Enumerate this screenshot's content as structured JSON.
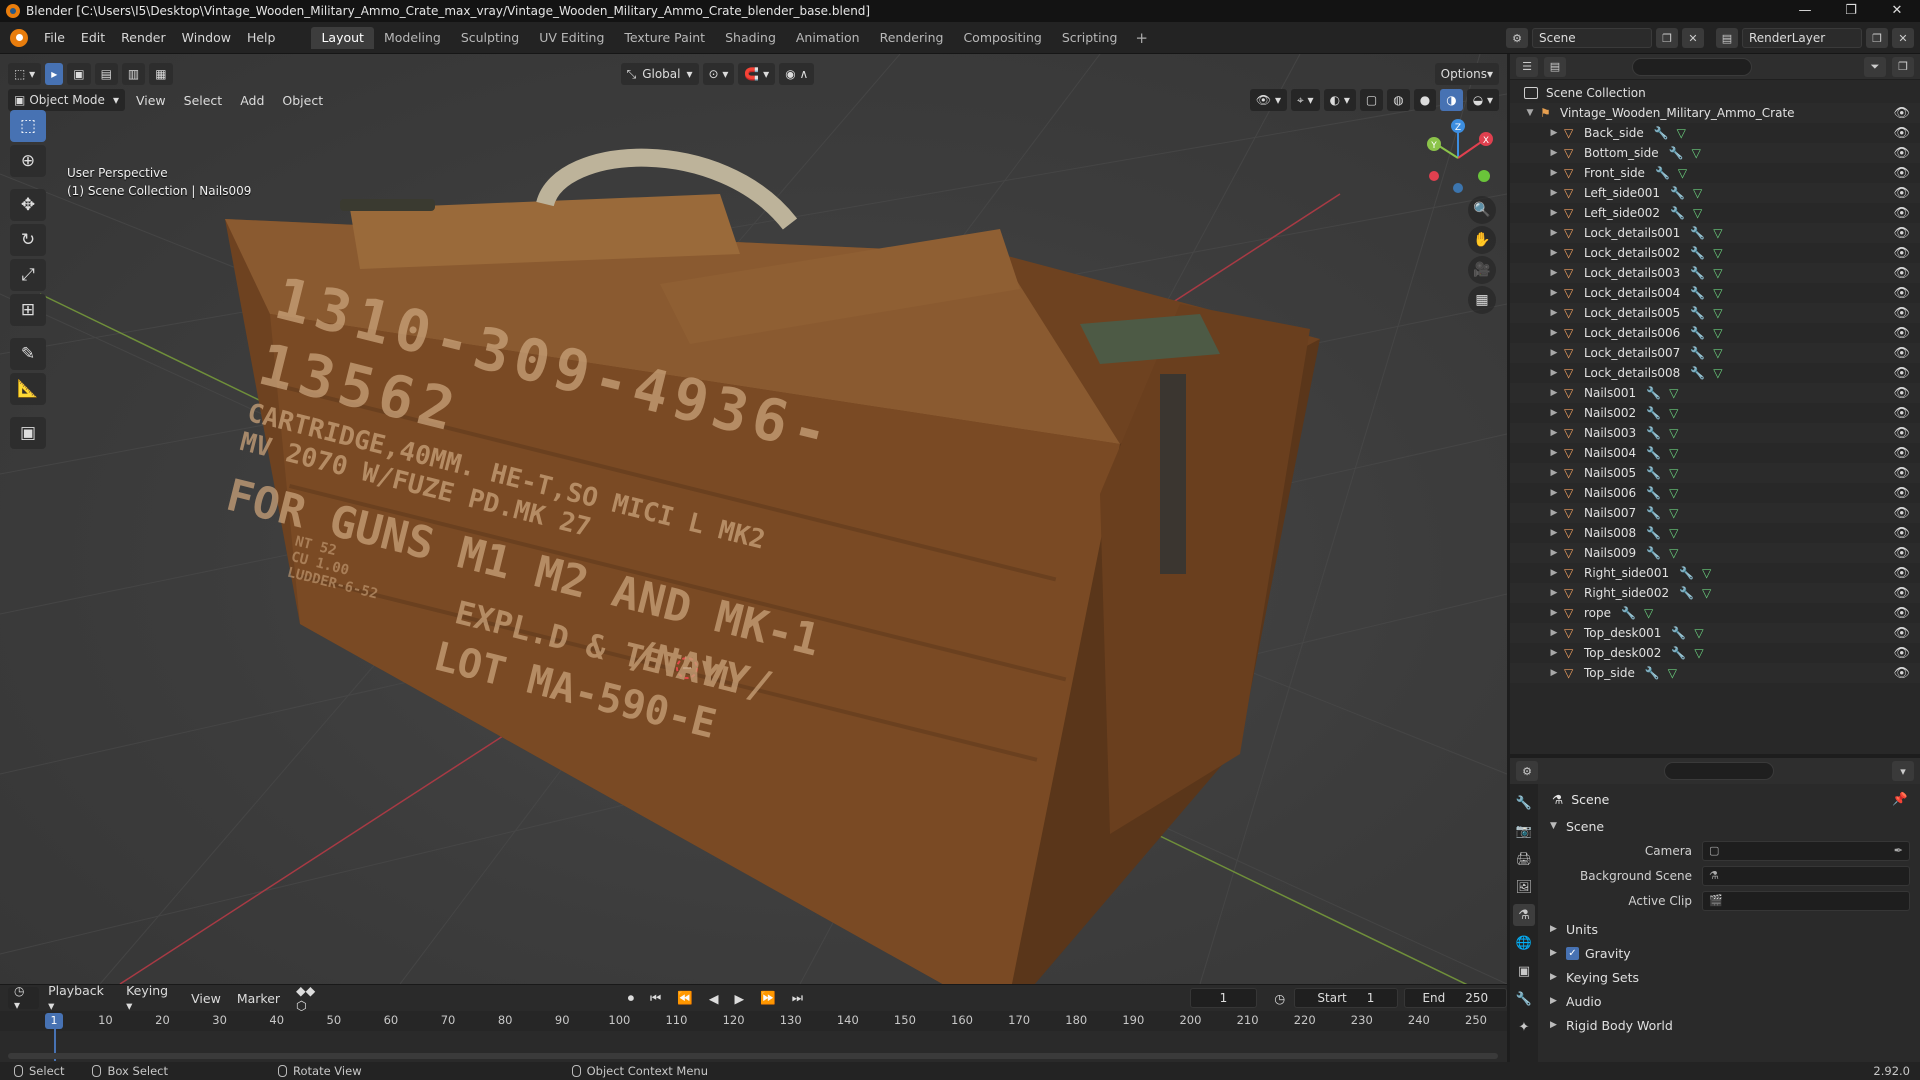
{
  "window": {
    "title": "Blender [C:\\Users\\I5\\Desktop\\Vintage_Wooden_Military_Ammo_Crate_max_vray/Vintage_Wooden_Military_Ammo_Crate_blender_base.blend]",
    "controls": {
      "minimize": "—",
      "maximize": "❐",
      "close": "✕"
    }
  },
  "menu": [
    "File",
    "Edit",
    "Render",
    "Window",
    "Help"
  ],
  "workspaces": [
    {
      "label": "Layout",
      "active": true
    },
    {
      "label": "Modeling"
    },
    {
      "label": "Sculpting"
    },
    {
      "label": "UV Editing"
    },
    {
      "label": "Texture Paint"
    },
    {
      "label": "Shading"
    },
    {
      "label": "Animation"
    },
    {
      "label": "Rendering"
    },
    {
      "label": "Compositing"
    },
    {
      "label": "Scripting"
    }
  ],
  "workspace_add": "+",
  "scene_selector": {
    "scene": "Scene",
    "view_layer": "RenderLayer"
  },
  "viewport": {
    "transform_orientation": "Global",
    "options_label": "Options",
    "mode": "Object Mode",
    "menus": [
      "View",
      "Select",
      "Add",
      "Object"
    ],
    "perspective_label": "User Perspective",
    "collection_info": "(1) Scene Collection | Nails009",
    "axes": {
      "x": "X",
      "y": "Y",
      "z": "Z"
    }
  },
  "model_text": {
    "line1": "1310-309-4936-13562",
    "line2": "CARTRIDGE,40MM. HE-T,SO MICI L MK2",
    "line3": "MV 2070 W/FUZE PD.MK 27",
    "line4": "FOR GUNS M1 M2 AND MK-1",
    "line5": "EXPL.D & TETRYL",
    "line6": "/NAVY/",
    "line7": "LOT MA-590-E",
    "side1": "NT 52",
    "side2": "CU 1.00",
    "side3": "LUDDER-6-52"
  },
  "outliner": {
    "root": "Scene Collection",
    "collection": "Vintage_Wooden_Military_Ammo_Crate",
    "objects": [
      "Back_side",
      "Bottom_side",
      "Front_side",
      "Left_side001",
      "Left_side002",
      "Lock_details001",
      "Lock_details002",
      "Lock_details003",
      "Lock_details004",
      "Lock_details005",
      "Lock_details006",
      "Lock_details007",
      "Lock_details008",
      "Nails001",
      "Nails002",
      "Nails003",
      "Nails004",
      "Nails005",
      "Nails006",
      "Nails007",
      "Nails008",
      "Nails009",
      "Right_side001",
      "Right_side002",
      "rope",
      "Top_desk001",
      "Top_desk002",
      "Top_side"
    ]
  },
  "properties": {
    "context": "Scene",
    "panel": "Scene",
    "fields": [
      {
        "label": "Camera"
      },
      {
        "label": "Background Scene"
      },
      {
        "label": "Active Clip"
      }
    ],
    "subpanels": [
      "Units",
      "Gravity",
      "Keying Sets",
      "Audio",
      "Rigid Body World"
    ],
    "gravity_checked": true
  },
  "timeline": {
    "menus": [
      "Playback",
      "Keying",
      "View",
      "Marker"
    ],
    "current_frame": "1",
    "start_label": "Start",
    "start": "1",
    "end_label": "End",
    "end": "250",
    "ticks": [
      "1",
      "10",
      "20",
      "30",
      "40",
      "50",
      "60",
      "70",
      "80",
      "90",
      "100",
      "110",
      "120",
      "130",
      "140",
      "150",
      "160",
      "170",
      "180",
      "190",
      "200",
      "210",
      "220",
      "230",
      "240",
      "250"
    ]
  },
  "statusbar": {
    "select": "Select",
    "box_select": "Box Select",
    "rotate_view": "Rotate View",
    "context_menu": "Object Context Menu",
    "version": "2.92.0"
  },
  "colors": {
    "accent": "#4772b3",
    "axis_x": "#e0404f",
    "axis_y": "#8bc34a",
    "axis_z": "#3d8ee0",
    "wood": "#7a4a22"
  }
}
